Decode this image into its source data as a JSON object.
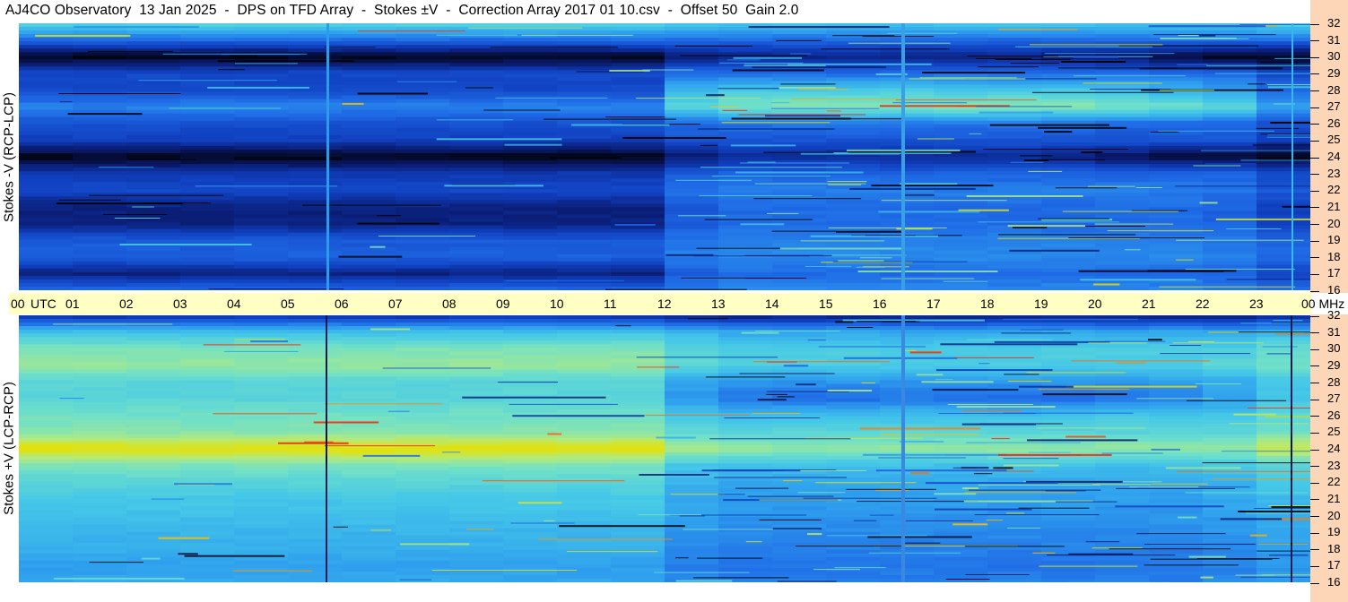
{
  "header": {
    "title": "AJ4CO Observatory  13 Jan 2025  -  DPS on TFD Array  -  Stokes ±V  -  Correction Array 2017 01 10.csv  -  Offset 50  Gain 2.0"
  },
  "panels": {
    "top_label": "Stokes -V (RCP-LCP)",
    "bottom_label": "Stokes +V (LCP-RCP)"
  },
  "time_axis": {
    "labels": [
      "00",
      "UTC",
      "01",
      "02",
      "03",
      "04",
      "05",
      "06",
      "07",
      "08",
      "09",
      "10",
      "11",
      "12",
      "13",
      "14",
      "15",
      "16",
      "17",
      "18",
      "19",
      "20",
      "21",
      "22",
      "23",
      "00 MHz"
    ]
  },
  "freq_axis": {
    "labels": [
      "32",
      "31",
      "30",
      "29",
      "28",
      "27",
      "26",
      "25",
      "24",
      "23",
      "22",
      "21",
      "20",
      "19",
      "18",
      "17",
      "16"
    ]
  },
  "colors": {
    "time_bar": "#ffffc4",
    "freq_column": "#fcd6b6",
    "colormap": [
      "#000000",
      "#0a1a6e",
      "#1040c0",
      "#1f6ae6",
      "#2fa0ee",
      "#45c8e8",
      "#70e0c8",
      "#b0ea80",
      "#e8e000",
      "#ff9000",
      "#ff2000"
    ]
  },
  "chart_data": [
    {
      "type": "heatmap",
      "title": "Stokes -V (RCP-LCP)",
      "xlabel": "UTC",
      "ylabel": "MHz",
      "xlim": [
        0,
        24
      ],
      "ylim": [
        16,
        32
      ],
      "x": [
        "00",
        "01",
        "02",
        "03",
        "04",
        "05",
        "06",
        "07",
        "08",
        "09",
        "10",
        "11",
        "12",
        "13",
        "14",
        "15",
        "16",
        "17",
        "18",
        "19",
        "20",
        "21",
        "22",
        "23",
        "00"
      ],
      "y": [
        32,
        31,
        30,
        29,
        28,
        27,
        26,
        25,
        24,
        23,
        22,
        21,
        20,
        19,
        18,
        17,
        16
      ],
      "values": [
        [
          0.55,
          0.55,
          0.55,
          0.55,
          0.55,
          0.55,
          0.55,
          0.55,
          0.55,
          0.55,
          0.55,
          0.55,
          0.5,
          0.5,
          0.5,
          0.5,
          0.5,
          0.5,
          0.5,
          0.5,
          0.5,
          0.5,
          0.5,
          0.55
        ],
        [
          0.3,
          0.3,
          0.3,
          0.3,
          0.3,
          0.3,
          0.3,
          0.3,
          0.3,
          0.3,
          0.3,
          0.3,
          0.3,
          0.3,
          0.3,
          0.3,
          0.3,
          0.3,
          0.3,
          0.3,
          0.3,
          0.3,
          0.3,
          0.3
        ],
        [
          0.02,
          0.02,
          0.02,
          0.02,
          0.02,
          0.02,
          0.02,
          0.02,
          0.02,
          0.02,
          0.02,
          0.02,
          0.1,
          0.12,
          0.12,
          0.12,
          0.12,
          0.12,
          0.12,
          0.1,
          0.08,
          0.05,
          0.03,
          0.02
        ],
        [
          0.22,
          0.22,
          0.22,
          0.22,
          0.22,
          0.22,
          0.22,
          0.22,
          0.22,
          0.22,
          0.22,
          0.22,
          0.3,
          0.3,
          0.3,
          0.3,
          0.3,
          0.3,
          0.3,
          0.3,
          0.3,
          0.3,
          0.3,
          0.22
        ],
        [
          0.22,
          0.22,
          0.22,
          0.22,
          0.22,
          0.22,
          0.22,
          0.22,
          0.22,
          0.22,
          0.22,
          0.22,
          0.45,
          0.5,
          0.5,
          0.5,
          0.52,
          0.5,
          0.5,
          0.5,
          0.48,
          0.45,
          0.4,
          0.3
        ],
        [
          0.35,
          0.35,
          0.35,
          0.35,
          0.35,
          0.35,
          0.35,
          0.35,
          0.35,
          0.35,
          0.35,
          0.35,
          0.55,
          0.62,
          0.65,
          0.65,
          0.62,
          0.65,
          0.65,
          0.65,
          0.62,
          0.6,
          0.55,
          0.4
        ],
        [
          0.24,
          0.24,
          0.24,
          0.24,
          0.24,
          0.24,
          0.24,
          0.24,
          0.24,
          0.24,
          0.24,
          0.24,
          0.3,
          0.32,
          0.32,
          0.32,
          0.32,
          0.32,
          0.32,
          0.32,
          0.3,
          0.3,
          0.3,
          0.24
        ],
        [
          0.2,
          0.2,
          0.2,
          0.2,
          0.2,
          0.2,
          0.2,
          0.2,
          0.2,
          0.2,
          0.2,
          0.2,
          0.25,
          0.25,
          0.25,
          0.25,
          0.25,
          0.25,
          0.25,
          0.25,
          0.25,
          0.25,
          0.25,
          0.2
        ],
        [
          0.02,
          0.02,
          0.02,
          0.02,
          0.02,
          0.02,
          0.02,
          0.02,
          0.02,
          0.02,
          0.02,
          0.02,
          0.1,
          0.14,
          0.14,
          0.14,
          0.14,
          0.14,
          0.14,
          0.12,
          0.08,
          0.05,
          0.04,
          0.02
        ],
        [
          0.18,
          0.18,
          0.18,
          0.18,
          0.18,
          0.18,
          0.18,
          0.18,
          0.18,
          0.18,
          0.18,
          0.18,
          0.26,
          0.28,
          0.28,
          0.28,
          0.28,
          0.28,
          0.28,
          0.28,
          0.28,
          0.28,
          0.28,
          0.22
        ],
        [
          0.22,
          0.22,
          0.22,
          0.22,
          0.22,
          0.22,
          0.22,
          0.22,
          0.22,
          0.22,
          0.22,
          0.22,
          0.32,
          0.34,
          0.34,
          0.34,
          0.34,
          0.34,
          0.34,
          0.34,
          0.34,
          0.34,
          0.32,
          0.26
        ],
        [
          0.12,
          0.12,
          0.12,
          0.12,
          0.12,
          0.12,
          0.12,
          0.12,
          0.12,
          0.12,
          0.12,
          0.12,
          0.26,
          0.3,
          0.3,
          0.3,
          0.3,
          0.3,
          0.3,
          0.3,
          0.3,
          0.3,
          0.28,
          0.2
        ],
        [
          0.12,
          0.12,
          0.12,
          0.12,
          0.12,
          0.12,
          0.12,
          0.12,
          0.12,
          0.12,
          0.12,
          0.12,
          0.26,
          0.3,
          0.3,
          0.3,
          0.3,
          0.3,
          0.3,
          0.3,
          0.3,
          0.3,
          0.28,
          0.2
        ],
        [
          0.26,
          0.26,
          0.26,
          0.26,
          0.26,
          0.26,
          0.26,
          0.26,
          0.26,
          0.26,
          0.26,
          0.26,
          0.32,
          0.34,
          0.34,
          0.34,
          0.34,
          0.34,
          0.34,
          0.34,
          0.34,
          0.34,
          0.32,
          0.28
        ],
        [
          0.28,
          0.28,
          0.28,
          0.28,
          0.28,
          0.28,
          0.28,
          0.28,
          0.28,
          0.28,
          0.28,
          0.28,
          0.34,
          0.36,
          0.36,
          0.36,
          0.36,
          0.36,
          0.36,
          0.36,
          0.36,
          0.36,
          0.34,
          0.3
        ],
        [
          0.12,
          0.12,
          0.12,
          0.12,
          0.12,
          0.12,
          0.12,
          0.12,
          0.12,
          0.12,
          0.12,
          0.12,
          0.26,
          0.3,
          0.3,
          0.3,
          0.3,
          0.3,
          0.3,
          0.3,
          0.3,
          0.3,
          0.28,
          0.2
        ],
        [
          0.3,
          0.3,
          0.3,
          0.3,
          0.3,
          0.3,
          0.3,
          0.3,
          0.3,
          0.3,
          0.3,
          0.3,
          0.34,
          0.36,
          0.36,
          0.36,
          0.36,
          0.36,
          0.36,
          0.36,
          0.36,
          0.36,
          0.34,
          0.32
        ]
      ]
    },
    {
      "type": "heatmap",
      "title": "Stokes +V (LCP-RCP)",
      "xlabel": "UTC",
      "ylabel": "MHz",
      "xlim": [
        0,
        24
      ],
      "ylim": [
        16,
        32
      ],
      "x": [
        "00",
        "01",
        "02",
        "03",
        "04",
        "05",
        "06",
        "07",
        "08",
        "09",
        "10",
        "11",
        "12",
        "13",
        "14",
        "15",
        "16",
        "17",
        "18",
        "19",
        "20",
        "21",
        "22",
        "23",
        "00"
      ],
      "y": [
        32,
        31,
        30,
        29,
        28,
        27,
        26,
        25,
        24,
        23,
        22,
        21,
        20,
        19,
        18,
        17,
        16
      ],
      "values": [
        [
          0.15,
          0.15,
          0.15,
          0.15,
          0.15,
          0.15,
          0.15,
          0.15,
          0.15,
          0.15,
          0.15,
          0.15,
          0.12,
          0.1,
          0.1,
          0.1,
          0.1,
          0.1,
          0.1,
          0.1,
          0.1,
          0.1,
          0.1,
          0.12
        ],
        [
          0.48,
          0.48,
          0.48,
          0.48,
          0.48,
          0.48,
          0.48,
          0.48,
          0.48,
          0.48,
          0.48,
          0.48,
          0.45,
          0.42,
          0.42,
          0.42,
          0.42,
          0.42,
          0.42,
          0.42,
          0.42,
          0.42,
          0.42,
          0.45
        ],
        [
          0.62,
          0.62,
          0.62,
          0.62,
          0.62,
          0.62,
          0.62,
          0.62,
          0.62,
          0.62,
          0.62,
          0.62,
          0.55,
          0.52,
          0.52,
          0.52,
          0.52,
          0.52,
          0.52,
          0.52,
          0.52,
          0.52,
          0.52,
          0.58
        ],
        [
          0.66,
          0.66,
          0.66,
          0.66,
          0.66,
          0.66,
          0.66,
          0.66,
          0.66,
          0.66,
          0.66,
          0.66,
          0.56,
          0.52,
          0.52,
          0.52,
          0.52,
          0.52,
          0.52,
          0.52,
          0.52,
          0.52,
          0.55,
          0.6
        ],
        [
          0.55,
          0.55,
          0.55,
          0.55,
          0.55,
          0.55,
          0.55,
          0.55,
          0.55,
          0.55,
          0.55,
          0.55,
          0.42,
          0.38,
          0.38,
          0.38,
          0.38,
          0.38,
          0.38,
          0.38,
          0.38,
          0.4,
          0.42,
          0.5
        ],
        [
          0.55,
          0.55,
          0.55,
          0.55,
          0.55,
          0.55,
          0.55,
          0.55,
          0.55,
          0.55,
          0.55,
          0.55,
          0.38,
          0.32,
          0.3,
          0.3,
          0.32,
          0.3,
          0.3,
          0.3,
          0.32,
          0.34,
          0.4,
          0.5
        ],
        [
          0.6,
          0.6,
          0.6,
          0.6,
          0.6,
          0.6,
          0.6,
          0.6,
          0.6,
          0.6,
          0.6,
          0.6,
          0.5,
          0.48,
          0.48,
          0.48,
          0.48,
          0.48,
          0.48,
          0.48,
          0.5,
          0.5,
          0.5,
          0.56
        ],
        [
          0.64,
          0.64,
          0.64,
          0.64,
          0.64,
          0.64,
          0.64,
          0.64,
          0.64,
          0.64,
          0.64,
          0.64,
          0.56,
          0.55,
          0.55,
          0.55,
          0.55,
          0.55,
          0.55,
          0.55,
          0.55,
          0.55,
          0.55,
          0.6
        ],
        [
          0.8,
          0.8,
          0.8,
          0.8,
          0.8,
          0.8,
          0.8,
          0.8,
          0.8,
          0.8,
          0.8,
          0.8,
          0.7,
          0.66,
          0.66,
          0.66,
          0.66,
          0.66,
          0.66,
          0.66,
          0.66,
          0.66,
          0.66,
          0.75
        ],
        [
          0.62,
          0.62,
          0.62,
          0.62,
          0.62,
          0.62,
          0.62,
          0.62,
          0.62,
          0.62,
          0.62,
          0.62,
          0.5,
          0.48,
          0.48,
          0.48,
          0.48,
          0.48,
          0.48,
          0.48,
          0.48,
          0.48,
          0.5,
          0.56
        ],
        [
          0.55,
          0.55,
          0.55,
          0.55,
          0.55,
          0.55,
          0.55,
          0.55,
          0.55,
          0.55,
          0.55,
          0.55,
          0.45,
          0.42,
          0.42,
          0.42,
          0.42,
          0.42,
          0.42,
          0.42,
          0.42,
          0.42,
          0.45,
          0.5
        ],
        [
          0.5,
          0.5,
          0.5,
          0.5,
          0.5,
          0.5,
          0.5,
          0.5,
          0.5,
          0.5,
          0.5,
          0.5,
          0.42,
          0.4,
          0.4,
          0.4,
          0.4,
          0.4,
          0.4,
          0.4,
          0.4,
          0.4,
          0.42,
          0.46
        ],
        [
          0.48,
          0.48,
          0.48,
          0.48,
          0.48,
          0.48,
          0.48,
          0.48,
          0.48,
          0.48,
          0.48,
          0.48,
          0.4,
          0.38,
          0.38,
          0.38,
          0.38,
          0.38,
          0.38,
          0.38,
          0.38,
          0.38,
          0.4,
          0.44
        ],
        [
          0.45,
          0.45,
          0.45,
          0.45,
          0.45,
          0.45,
          0.45,
          0.45,
          0.45,
          0.45,
          0.45,
          0.45,
          0.38,
          0.36,
          0.36,
          0.36,
          0.36,
          0.36,
          0.36,
          0.36,
          0.36,
          0.36,
          0.38,
          0.42
        ],
        [
          0.44,
          0.44,
          0.44,
          0.44,
          0.44,
          0.44,
          0.44,
          0.44,
          0.44,
          0.44,
          0.44,
          0.44,
          0.36,
          0.34,
          0.34,
          0.34,
          0.34,
          0.34,
          0.34,
          0.34,
          0.34,
          0.34,
          0.36,
          0.4
        ],
        [
          0.4,
          0.4,
          0.4,
          0.4,
          0.4,
          0.4,
          0.4,
          0.4,
          0.4,
          0.4,
          0.4,
          0.4,
          0.34,
          0.32,
          0.32,
          0.32,
          0.32,
          0.32,
          0.32,
          0.32,
          0.32,
          0.32,
          0.34,
          0.38
        ],
        [
          0.42,
          0.42,
          0.42,
          0.42,
          0.42,
          0.42,
          0.42,
          0.42,
          0.42,
          0.42,
          0.42,
          0.42,
          0.36,
          0.34,
          0.34,
          0.34,
          0.34,
          0.34,
          0.34,
          0.34,
          0.34,
          0.34,
          0.36,
          0.4
        ]
      ]
    }
  ]
}
